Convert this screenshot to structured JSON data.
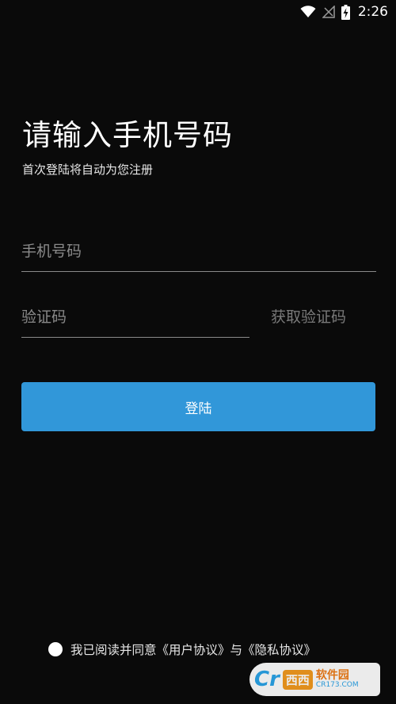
{
  "status_bar": {
    "time": "2:26",
    "icons": [
      "wifi-icon",
      "signal-icon",
      "battery-charging-icon"
    ]
  },
  "header": {
    "title": "请输入手机号码",
    "subtitle": "首次登陆将自动为您注册"
  },
  "form": {
    "phone_placeholder": "手机号码",
    "phone_value": "",
    "code_placeholder": "验证码",
    "code_value": "",
    "get_code_label": "获取验证码",
    "login_label": "登陆"
  },
  "agreement": {
    "checked": false,
    "prefix": "我已阅读并同意",
    "user_agreement": "《用户协议》",
    "connector": "与",
    "privacy_policy": "《隐私协议》"
  },
  "watermark": {
    "logo": "Cr",
    "pill": "西西",
    "name": "软件园",
    "domain": "CR173.COM"
  },
  "colors": {
    "background": "#0a0a0a",
    "accent": "#3197d9",
    "placeholder": "#8a8a8a"
  }
}
